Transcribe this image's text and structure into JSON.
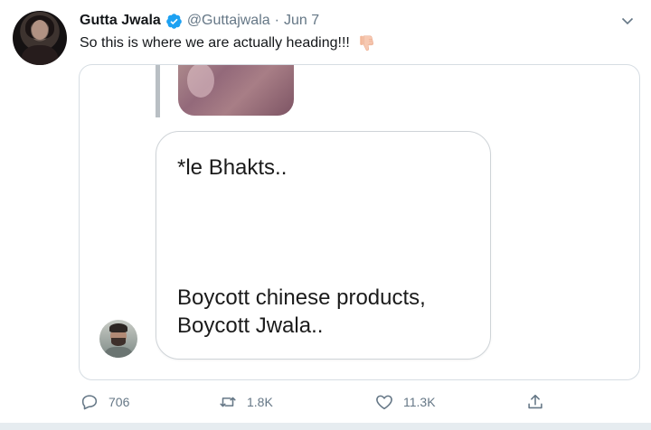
{
  "tweet": {
    "author_name": "Gutta Jwala",
    "author_handle": "@Guttajwala",
    "separator": "·",
    "date": "Jun 7",
    "text": "So this is where we are actually heading!!!"
  },
  "icons": {
    "verified": "verified-badge-icon",
    "caret": "chevron-down-icon",
    "emoji": "thumbs-down-emoji",
    "reply": "reply-icon",
    "retweet": "retweet-icon",
    "like": "heart-icon",
    "share": "share-icon"
  },
  "media": {
    "bubble_lines": [
      "*le Bhakts..",
      "Boycott chinese products,",
      "Boycott Jwala.."
    ]
  },
  "actions": {
    "reply_count": "706",
    "retweet_count": "1.8K",
    "like_count": "11.3K"
  },
  "colors": {
    "verified_blue": "#1da1f2",
    "muted_text": "#657786",
    "card_border": "#d6dde3"
  }
}
